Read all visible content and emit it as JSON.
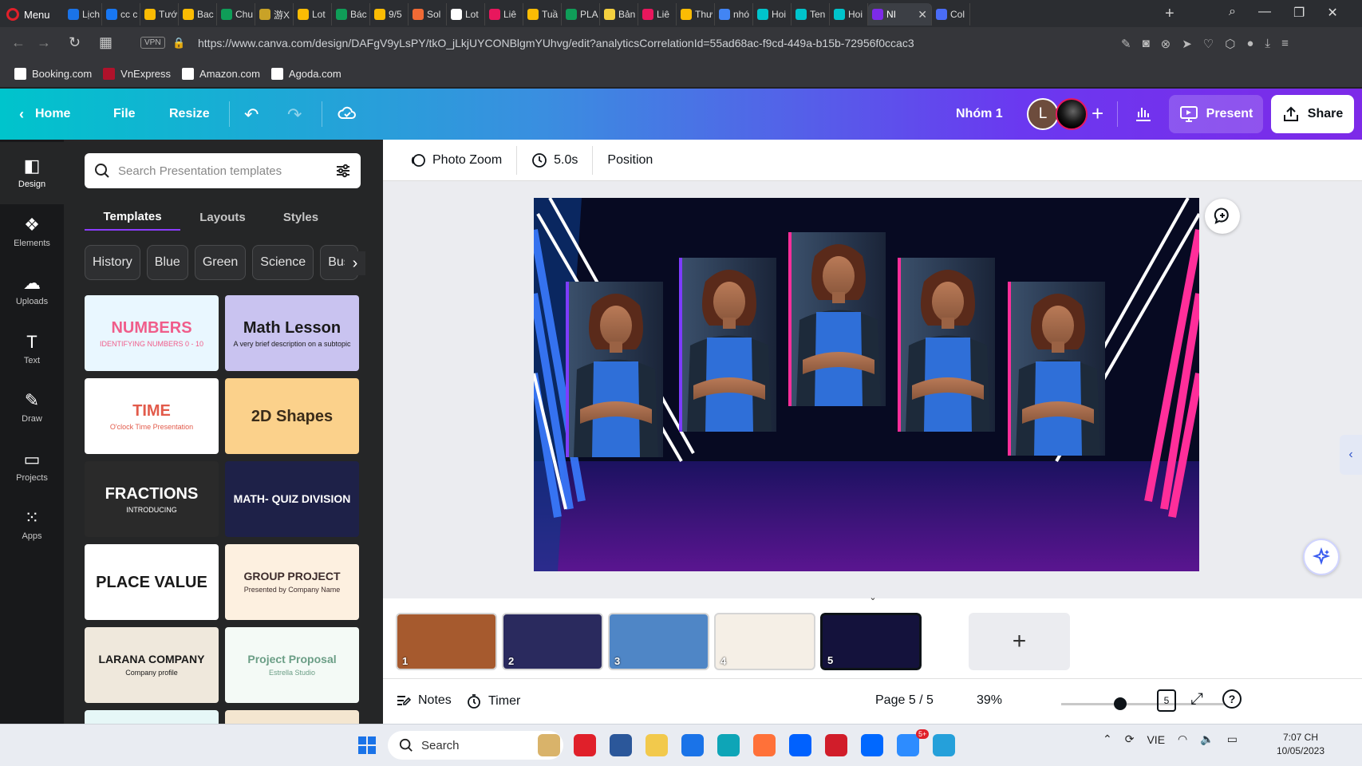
{
  "browser": {
    "menu_label": "Menu",
    "tabs": [
      {
        "label": "Lịch",
        "color": "#1a73e8"
      },
      {
        "label": "cc c",
        "color": "#1877f2"
      },
      {
        "label": "Tướ",
        "color": "#fbbc04"
      },
      {
        "label": "Bac",
        "color": "#fbbc04"
      },
      {
        "label": "Chu",
        "color": "#0f9d58"
      },
      {
        "label": "游X",
        "color": "#c9a227"
      },
      {
        "label": "Lot",
        "color": "#fbbc04"
      },
      {
        "label": "Bác",
        "color": "#0f9d58"
      },
      {
        "label": "9/5",
        "color": "#fbbc04"
      },
      {
        "label": "Sol",
        "color": "#f06a35"
      },
      {
        "label": "Lot",
        "color": "#ffffff"
      },
      {
        "label": "Liê",
        "color": "#e8175d"
      },
      {
        "label": "Tuầ",
        "color": "#fbbc04"
      },
      {
        "label": "PLA",
        "color": "#0f9d58"
      },
      {
        "label": "Bản",
        "color": "#f4d03f"
      },
      {
        "label": "Liê",
        "color": "#e8175d"
      },
      {
        "label": "Thư",
        "color": "#fbbc04"
      },
      {
        "label": "nhó",
        "color": "#4285f4"
      },
      {
        "label": "Hoi",
        "color": "#00c4cc"
      },
      {
        "label": "Ten",
        "color": "#00c4cc"
      },
      {
        "label": "Hoi",
        "color": "#00c4cc"
      }
    ],
    "active_tab": {
      "label": "NI",
      "color": "#7d2ae8"
    },
    "after_tab": {
      "label": "Col",
      "color": "#4a6cf7"
    },
    "url": "https://www.canva.com/design/DAFgV9yLsPY/tkO_jLkjUYCONBlgmYUhvg/edit?analyticsCorrelationId=55ad68ac-f9cd-449a-b15b-72956f0ccac3",
    "vpn_label": "VPN",
    "bookmarks": [
      {
        "label": "Booking.com",
        "color": "#ffffff"
      },
      {
        "label": "VnExpress",
        "color": "#b0122b"
      },
      {
        "label": "Amazon.com",
        "color": "#ffffff"
      },
      {
        "label": "Agoda.com",
        "color": "#ffffff"
      }
    ]
  },
  "header": {
    "home": "Home",
    "file": "File",
    "resize": "Resize",
    "team_name": "Nhóm 1",
    "avatar_initial": "L",
    "present": "Present",
    "share": "Share"
  },
  "rail": [
    {
      "label": "Design",
      "icon": "layout-icon"
    },
    {
      "label": "Elements",
      "icon": "elements-icon"
    },
    {
      "label": "Uploads",
      "icon": "upload-icon"
    },
    {
      "label": "Text",
      "icon": "text-icon"
    },
    {
      "label": "Draw",
      "icon": "draw-icon"
    },
    {
      "label": "Projects",
      "icon": "folder-icon"
    },
    {
      "label": "Apps",
      "icon": "apps-icon"
    }
  ],
  "panel": {
    "search_placeholder": "Search Presentation templates",
    "tabs": [
      "Templates",
      "Layouts",
      "Styles"
    ],
    "chips": [
      "History",
      "Blue",
      "Green",
      "Science",
      "Bus"
    ],
    "templates": [
      {
        "title": "NUMBERS",
        "sub": "IDENTIFYING NUMBERS 0 - 10",
        "bg": "#e9f7ff",
        "fg": "#f05d8a"
      },
      {
        "title": "Math Lesson",
        "sub": "A very brief description on a subtopic",
        "bg": "#c9c3f0",
        "fg": "#1a1a1a"
      },
      {
        "title": "TIME",
        "sub": "O'clock Time Presentation",
        "bg": "#ffffff",
        "fg": "#e25b4b"
      },
      {
        "title": "2D Shapes",
        "sub": "",
        "bg": "#fbd18b",
        "fg": "#3a2c1a"
      },
      {
        "title": "FRACTIONS",
        "sub": "INTRODUCING",
        "bg": "#2a2a2a",
        "fg": "#ffffff"
      },
      {
        "title": "MATH- QUIZ DIVISION",
        "sub": "",
        "bg": "#1e2148",
        "fg": "#ffffff"
      },
      {
        "title": "PLACE VALUE",
        "sub": "",
        "bg": "#ffffff",
        "fg": "#1a1a1a"
      },
      {
        "title": "GROUP PROJECT",
        "sub": "Presented by Company Name",
        "bg": "#fdf0e0",
        "fg": "#3d2c2c"
      },
      {
        "title": "LARANA COMPANY",
        "sub": "Company profile",
        "bg": "#efe8dc",
        "fg": "#1a1a1a"
      },
      {
        "title": "Project Proposal",
        "sub": "Estrella Studio",
        "bg": "#f4faf6",
        "fg": "#6b9e86"
      }
    ]
  },
  "toolbar": {
    "photo_zoom": "Photo Zoom",
    "duration": "5.0s",
    "position": "Position"
  },
  "pages": [
    {
      "num": "1",
      "bg": "#a65a2e"
    },
    {
      "num": "2",
      "bg": "#2a2a5e"
    },
    {
      "num": "3",
      "bg": "#4f86c6"
    },
    {
      "num": "4",
      "bg": "#f5efe6"
    },
    {
      "num": "5",
      "bg": "#14123c"
    }
  ],
  "footer": {
    "notes": "Notes",
    "timer": "Timer",
    "page_indicator": "Page 5 / 5",
    "zoom": "39%",
    "page_count_badge": "5"
  },
  "taskbar": {
    "search": "Search",
    "lang": "VIE",
    "time": "7:07 CH",
    "date": "10/05/2023",
    "zalo_badge": "5+"
  },
  "colors": {
    "canva_purple": "#7d2ae8",
    "canva_teal": "#00c4cc",
    "slide_pink": "#ff2e9a",
    "slide_blue": "#2a63ff"
  }
}
